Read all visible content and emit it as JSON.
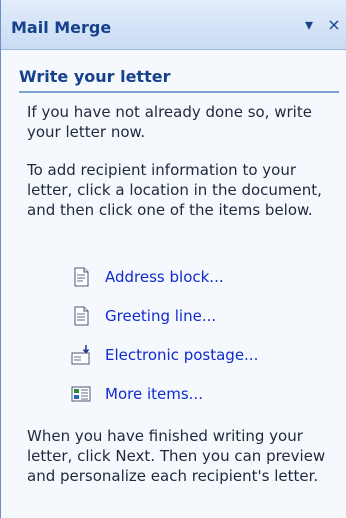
{
  "pane": {
    "title": "Mail Merge",
    "dropdown_glyph": "▾",
    "close_glyph": "×"
  },
  "section": {
    "heading": "Write your letter",
    "intro": "If you have not already done so, write your letter now.",
    "instructions": "To add recipient information to your letter, click a location in the document, and then click one of the items below.",
    "items": [
      {
        "label": "Address block...",
        "icon": "address-block-icon"
      },
      {
        "label": "Greeting line...",
        "icon": "greeting-line-icon"
      },
      {
        "label": "Electronic postage...",
        "icon": "electronic-postage-icon"
      },
      {
        "label": "More items...",
        "icon": "more-items-icon"
      }
    ],
    "footer": "When you have finished writing your letter, click Next. Then you can preview and personalize each recipient's letter."
  },
  "colors": {
    "title": "#15428b",
    "link": "#0f2acf",
    "rule": "#7ea2d4",
    "background": "#f5f8fd"
  }
}
